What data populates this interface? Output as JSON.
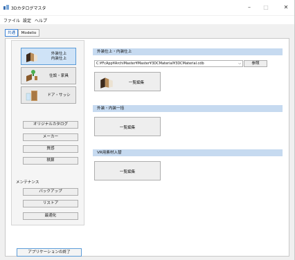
{
  "window": {
    "title": "3Dカタログマスタ",
    "minimize": "–",
    "maximize": "□",
    "close": "✕"
  },
  "menu": [
    "ファイル",
    "設定",
    "ヘルプ"
  ],
  "tabs": [
    "共通",
    "Modelio"
  ],
  "left": {
    "categories": [
      {
        "label": "外装仕上\n内装仕上",
        "icon": "material-samples-icon"
      },
      {
        "label": "住設・家具",
        "icon": "furniture-icon"
      },
      {
        "label": "ドア・サッシ",
        "icon": "door-sash-icon"
      }
    ],
    "buttons": [
      "オリジナルカタログ",
      "メーカー",
      "質感",
      "積算"
    ],
    "maintenance_label": "メンテナンス",
    "maintenance_buttons": [
      "バックアップ",
      "リストア",
      "最適化"
    ]
  },
  "right": {
    "section1": {
      "header": "外装仕上・内装仕上",
      "path": "C:¥FcApp¥ArchiMaster¥Master¥3DCMaterial¥3DCMaterial.cdb",
      "browse": "参照",
      "edit": "一覧編集"
    },
    "section2": {
      "header": "外装・内装一括",
      "edit": "一覧編集"
    },
    "section3": {
      "header": "VR用素材入替",
      "edit": "一覧編集"
    }
  },
  "exit_button": "アプリケーションの終了",
  "colors": {
    "accent": "#3b82d6",
    "header_bg": "#c6daf0",
    "selected_bg": "#cfe3f7"
  }
}
